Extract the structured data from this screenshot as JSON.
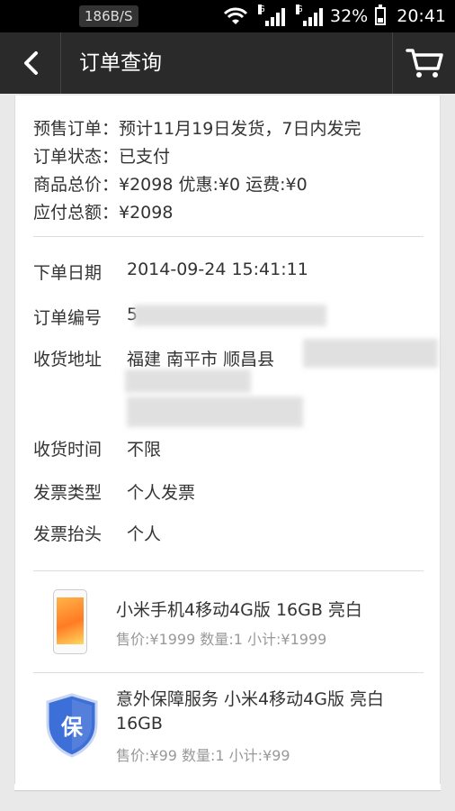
{
  "status_bar": {
    "net_speed": "186B/S",
    "network_type_1": "G",
    "network_type_2": "G",
    "battery_percent": "32%",
    "time": "20:41"
  },
  "header": {
    "title": "订单查询",
    "back_icon": "chevron-left-icon",
    "cart_icon": "cart-icon"
  },
  "summary": {
    "line1": "预售订单：预计11月19日发货，7日内发完",
    "line2": "订单状态：已支付",
    "line3": "商品总价：¥2098 优惠:¥0 运费:¥0",
    "line4": "应付总额：¥2098"
  },
  "details": {
    "order_date_label": "下单日期",
    "order_date_value": "2014-09-24 15:41:11",
    "order_no_label": "订单编号",
    "order_no_value": "5",
    "address_label": "收货地址",
    "address_value": "福建 南平市 顺昌县",
    "delivery_time_label": "收货时间",
    "delivery_time_value": "不限",
    "invoice_type_label": "发票类型",
    "invoice_type_value": "个人发票",
    "invoice_title_label": "发票抬头",
    "invoice_title_value": "个人"
  },
  "products": [
    {
      "name": "小米手机4移动4G版 16GB 亮白",
      "meta": "售价:¥1999 数量:1 小计:¥1999",
      "icon": "phone-image"
    },
    {
      "name": "意外保障服务 小米4移动4G版 亮白 16GB",
      "meta": "售价:¥99 数量:1 小计:¥99",
      "icon_text": "保",
      "icon": "shield-icon"
    }
  ],
  "colors": {
    "header_bg": "#2a2a2a",
    "shield_blue": "#3d6fd8",
    "phone_orange": "#ff7b24"
  }
}
